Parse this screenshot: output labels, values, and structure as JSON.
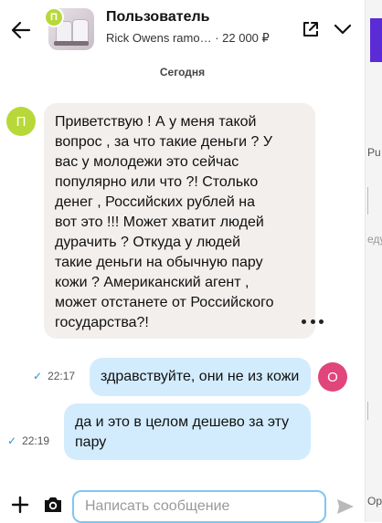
{
  "header": {
    "title": "Пользователь",
    "listing": "Rick Owens ramo…",
    "price": "· 22 000 ₽",
    "avatar_letter": "П"
  },
  "date_divider": "Сегодня",
  "messages": [
    {
      "direction": "incoming",
      "avatar_letter": "П",
      "avatar_color": "#b8d83a",
      "lines": [
        "Приветствую ! А у меня такой",
        "вопрос , за что такие деньги ? У",
        "вас у молодежи это сейчас",
        "популярно или что ?! Столько",
        "денег , Российских рублей на",
        "вот это !!! Может хватит людей",
        "дурачить ? Откуда у людей",
        "такие деньги на обычную пару",
        "кожи ? Американский агент ,",
        "может отстанете от Российского",
        "государства?!"
      ]
    },
    {
      "direction": "outgoing",
      "avatar_letter": "О",
      "avatar_color": "#e0457b",
      "time": "22:17",
      "lines": [
        "здравствуйте, они не из кожи"
      ]
    },
    {
      "direction": "outgoing",
      "time": "22:19",
      "lines": [
        "да и это в целом дешево за эту",
        "пару"
      ]
    }
  ],
  "composer": {
    "placeholder": "Написать сообщение"
  },
  "side_fragments": [
    "Pu",
    "еду",
    "Op"
  ],
  "colors": {
    "incoming_bubble": "#f2efed",
    "outgoing_bubble": "#d3ecfd",
    "input_border": "#80c6f4",
    "read_check": "#2a8fd6"
  }
}
